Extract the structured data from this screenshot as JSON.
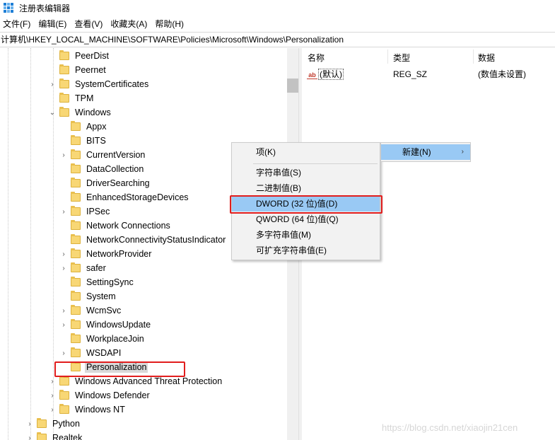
{
  "window": {
    "title": "注册表编辑器",
    "icon": "regedit-icon"
  },
  "menubar": [
    "文件(F)",
    "编辑(E)",
    "查看(V)",
    "收藏夹(A)",
    "帮助(H)"
  ],
  "address": "计算机\\HKEY_LOCAL_MACHINE\\SOFTWARE\\Policies\\Microsoft\\Windows\\Personalization",
  "tree": [
    {
      "label": "PeerDist",
      "level": 2,
      "expander": "none"
    },
    {
      "label": "Peernet",
      "level": 2,
      "expander": "none"
    },
    {
      "label": "SystemCertificates",
      "level": 2,
      "expander": "collapsed"
    },
    {
      "label": "TPM",
      "level": 2,
      "expander": "none"
    },
    {
      "label": "Windows",
      "level": 2,
      "expander": "expanded"
    },
    {
      "label": "Appx",
      "level": 3,
      "expander": "none"
    },
    {
      "label": "BITS",
      "level": 3,
      "expander": "none"
    },
    {
      "label": "CurrentVersion",
      "level": 3,
      "expander": "collapsed"
    },
    {
      "label": "DataCollection",
      "level": 3,
      "expander": "none"
    },
    {
      "label": "DriverSearching",
      "level": 3,
      "expander": "none"
    },
    {
      "label": "EnhancedStorageDevices",
      "level": 3,
      "expander": "none"
    },
    {
      "label": "IPSec",
      "level": 3,
      "expander": "collapsed"
    },
    {
      "label": "Network Connections",
      "level": 3,
      "expander": "none"
    },
    {
      "label": "NetworkConnectivityStatusIndicator",
      "level": 3,
      "expander": "none"
    },
    {
      "label": "NetworkProvider",
      "level": 3,
      "expander": "collapsed"
    },
    {
      "label": "safer",
      "level": 3,
      "expander": "collapsed"
    },
    {
      "label": "SettingSync",
      "level": 3,
      "expander": "none"
    },
    {
      "label": "System",
      "level": 3,
      "expander": "none"
    },
    {
      "label": "WcmSvc",
      "level": 3,
      "expander": "collapsed"
    },
    {
      "label": "WindowsUpdate",
      "level": 3,
      "expander": "collapsed"
    },
    {
      "label": "WorkplaceJoin",
      "level": 3,
      "expander": "none"
    },
    {
      "label": "WSDAPI",
      "level": 3,
      "expander": "collapsed"
    },
    {
      "label": "Personalization",
      "level": 3,
      "expander": "none",
      "selected": true
    },
    {
      "label": "Windows Advanced Threat Protection",
      "level": 2,
      "expander": "collapsed"
    },
    {
      "label": "Windows Defender",
      "level": 2,
      "expander": "collapsed"
    },
    {
      "label": "Windows NT",
      "level": 2,
      "expander": "collapsed"
    },
    {
      "label": "Python",
      "level": 1,
      "expander": "collapsed"
    },
    {
      "label": "Realtek",
      "level": 1,
      "expander": "collapsed"
    }
  ],
  "list": {
    "columns": [
      "名称",
      "类型",
      "数据"
    ],
    "rows": [
      {
        "name": "(默认)",
        "type": "REG_SZ",
        "data": "(数值未设置)",
        "icon": "ab"
      }
    ]
  },
  "context_menu": {
    "item_key": "项(K)",
    "items": [
      "字符串值(S)",
      "二进制值(B)",
      "DWORD (32 位)值(D)",
      "QWORD (64 位)值(Q)",
      "多字符串值(M)",
      "可扩充字符串值(E)"
    ],
    "highlighted_index": 2
  },
  "new_menu": {
    "label": "新建(N)",
    "arrow": "›"
  },
  "watermark": "https://blog.csdn.net/xiaojin21cen",
  "colors": {
    "highlight": "#99c9f4",
    "annotation_red": "#e11d1d",
    "folder": "#f8d775"
  }
}
